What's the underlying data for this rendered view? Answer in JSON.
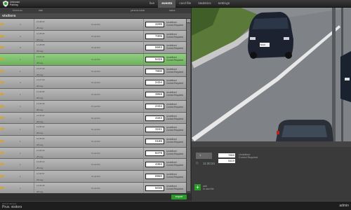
{
  "brand": {
    "line1": "Unknown",
    "line2": "Parking"
  },
  "nav": [
    "live",
    "events",
    "card file",
    "statistics",
    "settings"
  ],
  "columns": [
    "hh.mm.ss",
    "date",
    "",
    "persons name",
    "status"
  ],
  "section_title": "visitors",
  "rows": [
    {
      "num": "4",
      "time": "11:28:33",
      "date": "28 Aug",
      "dir": "P1 ENTR",
      "plate": "3295",
      "status": [
        "Undefined",
        "Control Required"
      ],
      "selected": false
    },
    {
      "num": "4",
      "time": "11:28:26",
      "date": "28 Aug",
      "dir": "P1 ENTR",
      "plate": "7305",
      "status": [
        "Undefined",
        "Control Required"
      ],
      "selected": false
    },
    {
      "num": "3",
      "time": "11:28:08",
      "date": "28 Aug",
      "dir": "P1 ENTR",
      "plate": "8683",
      "status": [
        "Undefined",
        "Control Required"
      ],
      "selected": false
    },
    {
      "num": "1",
      "time": "11:27:44",
      "date": "28 Aug",
      "dir": "P1 ENTR",
      "plate": "5419",
      "status": [
        "Undefined",
        "Control Required"
      ],
      "selected": true
    },
    {
      "num": "1",
      "time": "11:27:40",
      "date": "28 Aug",
      "dir": "P1 ENTR",
      "plate": "7800",
      "status": [
        "Undefined",
        "Control Required"
      ],
      "selected": false
    },
    {
      "num": "4",
      "time": "11:27:19",
      "date": "28 Aug",
      "dir": "P1 ENTR",
      "plate": "2434",
      "status": [
        "Undefined",
        "Control Required"
      ],
      "selected": false
    },
    {
      "num": "1",
      "time": "11:26:55",
      "date": "28 Aug",
      "dir": "P1 ENTR",
      "plate": "3959",
      "status": [
        "Undefined",
        "Control Required"
      ],
      "selected": false
    },
    {
      "num": "1",
      "time": "11:26:40",
      "date": "28 Aug",
      "dir": "P1 ENTR",
      "plate": "2434",
      "status": [
        "Undefined",
        "Control Required"
      ],
      "selected": false
    },
    {
      "num": "4",
      "time": "11:26:22",
      "date": "28 Aug",
      "dir": "P1 ENTR",
      "plate": "4343",
      "status": [
        "Undefined",
        "Control Required"
      ],
      "selected": false
    },
    {
      "num": "1",
      "time": "11:26:14",
      "date": "28 Aug",
      "dir": "P1 ENTR",
      "plate": "3241",
      "status": [
        "Undefined",
        "Control Required"
      ],
      "selected": false
    },
    {
      "num": "1",
      "time": "11:25:53",
      "date": "28 Aug",
      "dir": "P1 ENTR",
      "plate": "0185",
      "status": [
        "Undefined",
        "Control Required"
      ],
      "selected": false
    },
    {
      "num": "1",
      "time": "11:25:30",
      "date": "28 Aug",
      "dir": "P1 ENTR",
      "plate": "8478",
      "status": [
        "Undefined",
        "Control Required"
      ],
      "selected": false
    },
    {
      "num": "1",
      "time": "11:25:12",
      "date": "28 Aug",
      "dir": "P1 ENTR",
      "plate": "4394",
      "status": [
        "Undefined",
        "Control Required"
      ],
      "selected": false
    },
    {
      "num": "1",
      "time": "11:24:57",
      "date": "28 Aug",
      "dir": "P1 ENTR",
      "plate": "8950",
      "status": [
        "Undefined",
        "Control Required"
      ],
      "selected": false
    },
    {
      "num": "1",
      "time": "11:24:40",
      "date": "28 Aug",
      "dir": "P1 ENTR",
      "plate": "5035",
      "status": [
        "Undefined",
        "Control Required"
      ],
      "selected": false
    },
    {
      "num": "1",
      "time": "11:24:21",
      "date": "28 Aug",
      "dir": "P1 ENTR",
      "plate": "",
      "status": [
        "Undefined",
        "Control Required"
      ],
      "selected": false
    }
  ],
  "export_label": "export",
  "camera_plate": "5419",
  "detail": {
    "num": "1",
    "plate1": "7800",
    "plate2": "5419",
    "status": [
      "Undefined",
      "Control Required"
    ],
    "time": "11:30:24"
  },
  "add": {
    "line1": "add",
    "line2": "to card file"
  },
  "statusbar": {
    "label": "current camera",
    "value": "Pruv. visitors",
    "user": "admin"
  },
  "colors": {
    "selected": "#7fc06f",
    "accent": "#2b9a2b",
    "flag": "#e0a020"
  }
}
